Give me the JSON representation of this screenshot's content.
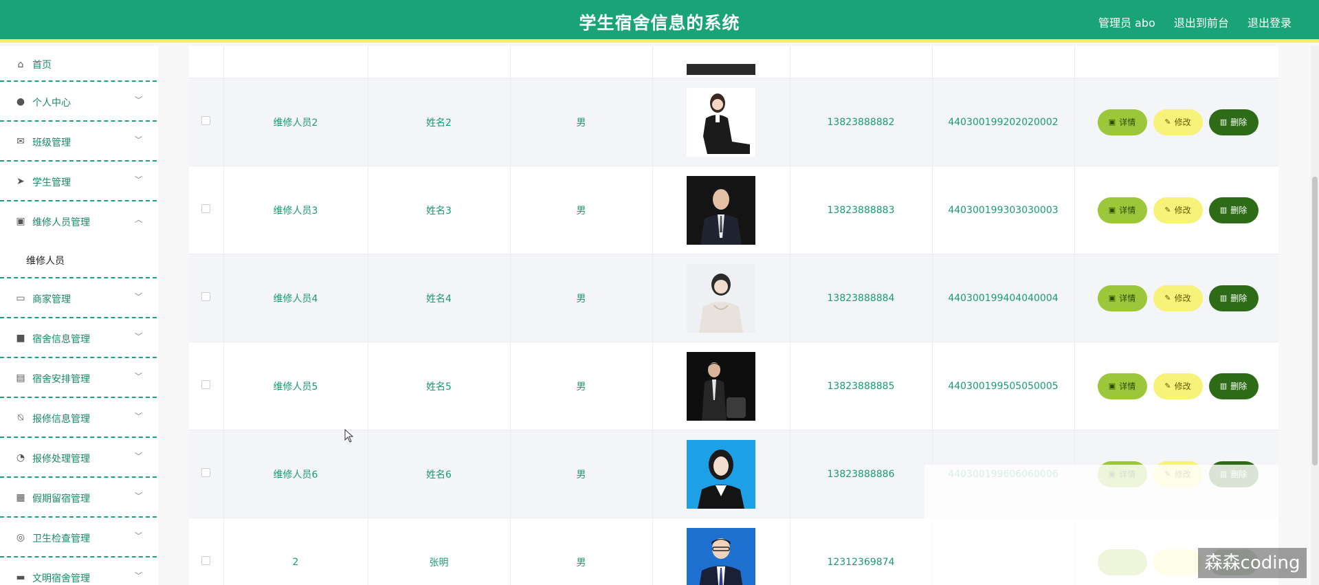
{
  "header": {
    "title": "学生宿舍信息的系统",
    "user_label": "管理员 abo",
    "front_link": "退出到前台",
    "logout_link": "退出登录"
  },
  "sidebar": {
    "items": [
      {
        "label": "首页",
        "icon": "home-icon"
      },
      {
        "label": "个人中心",
        "icon": "user-icon"
      },
      {
        "label": "班级管理",
        "icon": "mail-icon"
      },
      {
        "label": "学生管理",
        "icon": "send-icon"
      },
      {
        "label": "维修人员管理",
        "icon": "clipboard-x-icon"
      },
      {
        "label": "商家管理",
        "icon": "card-icon"
      },
      {
        "label": "宿舍信息管理",
        "icon": "briefcase-icon"
      },
      {
        "label": "宿舍安排管理",
        "icon": "clipboard-icon"
      },
      {
        "label": "报修信息管理",
        "icon": "bell-off-icon"
      },
      {
        "label": "报修处理管理",
        "icon": "compass-icon"
      },
      {
        "label": "假期留宿管理",
        "icon": "grid-icon"
      },
      {
        "label": "卫生检查管理",
        "icon": "lifebuoy-icon"
      },
      {
        "label": "文明宿舍管理",
        "icon": "chat-icon"
      }
    ],
    "submenu_label": "维修人员"
  },
  "table": {
    "rows": [
      {
        "account": "维修人员2",
        "name": "姓名2",
        "gender": "男",
        "phone": "13823888882",
        "id_card": "440300199202020002"
      },
      {
        "account": "维修人员3",
        "name": "姓名3",
        "gender": "男",
        "phone": "13823888883",
        "id_card": "440300199303030003"
      },
      {
        "account": "维修人员4",
        "name": "姓名4",
        "gender": "男",
        "phone": "13823888884",
        "id_card": "440300199404040004"
      },
      {
        "account": "维修人员5",
        "name": "姓名5",
        "gender": "男",
        "phone": "13823888885",
        "id_card": "440300199505050005"
      },
      {
        "account": "维修人员6",
        "name": "姓名6",
        "gender": "男",
        "phone": "13823888886",
        "id_card": "440300199606060006"
      },
      {
        "account": "2",
        "name": "张明",
        "gender": "男",
        "phone": "12312369874",
        "id_card": ""
      }
    ],
    "buttons": {
      "detail": "详情",
      "edit": "修改",
      "delete": "删除"
    }
  },
  "watermark": "森森coding",
  "colors": {
    "header": "#1aa376",
    "accent_bar": "#f8f25a",
    "text_green": "#1a9a6f",
    "detail_btn": "#9bc73a",
    "edit_btn": "#f7f27a",
    "delete_btn": "#2e6b17"
  }
}
